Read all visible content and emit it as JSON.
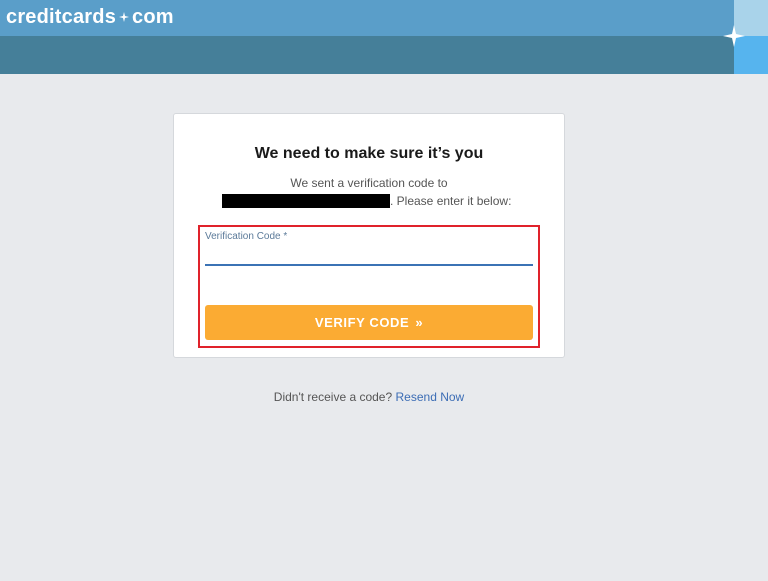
{
  "brand": {
    "logo_left": "creditcards",
    "logo_right": "com",
    "colors": {
      "header_top": "#5a9ec9",
      "header_bottom": "#457f99",
      "accent": "#fbab33",
      "link": "#3c6db5",
      "highlight": "#e0222b"
    }
  },
  "card": {
    "title": "We need to make sure it’s you",
    "message_line1": "We sent a verification code to",
    "message_line2_suffix": ". Please enter it below:"
  },
  "form": {
    "code_label": "Verification Code *",
    "code_value": "",
    "verify_label": "VERIFY CODE",
    "verify_icon": "double-chevron-right-icon"
  },
  "footer": {
    "prompt": "Didn't receive a code?",
    "resend_label": "Resend Now"
  }
}
